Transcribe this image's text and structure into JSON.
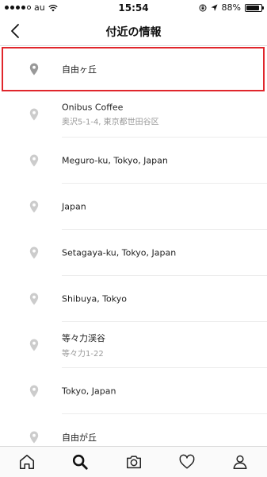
{
  "status_bar": {
    "carrier": "au",
    "time": "15:54",
    "battery_text": "88%",
    "battery_level": 0.88
  },
  "nav": {
    "title": "付近の情報"
  },
  "places": [
    {
      "name": "自由ヶ丘",
      "sub": ""
    },
    {
      "name": "Onibus Coffee",
      "sub": "奥沢5-1-4, 東京都世田谷区"
    },
    {
      "name": "Meguro-ku, Tokyo, Japan",
      "sub": ""
    },
    {
      "name": "Japan",
      "sub": ""
    },
    {
      "name": "Setagaya-ku, Tokyo, Japan",
      "sub": ""
    },
    {
      "name": "Shibuya, Tokyo",
      "sub": ""
    },
    {
      "name": "等々力渓谷",
      "sub": "等々力1-22"
    },
    {
      "name": "Tokyo, Japan",
      "sub": ""
    },
    {
      "name": "自由が丘",
      "sub": ""
    }
  ],
  "tab_bar": {
    "icons": [
      "home-icon",
      "search-icon",
      "camera-icon",
      "heart-icon",
      "profile-icon"
    ],
    "active": "search-icon"
  }
}
